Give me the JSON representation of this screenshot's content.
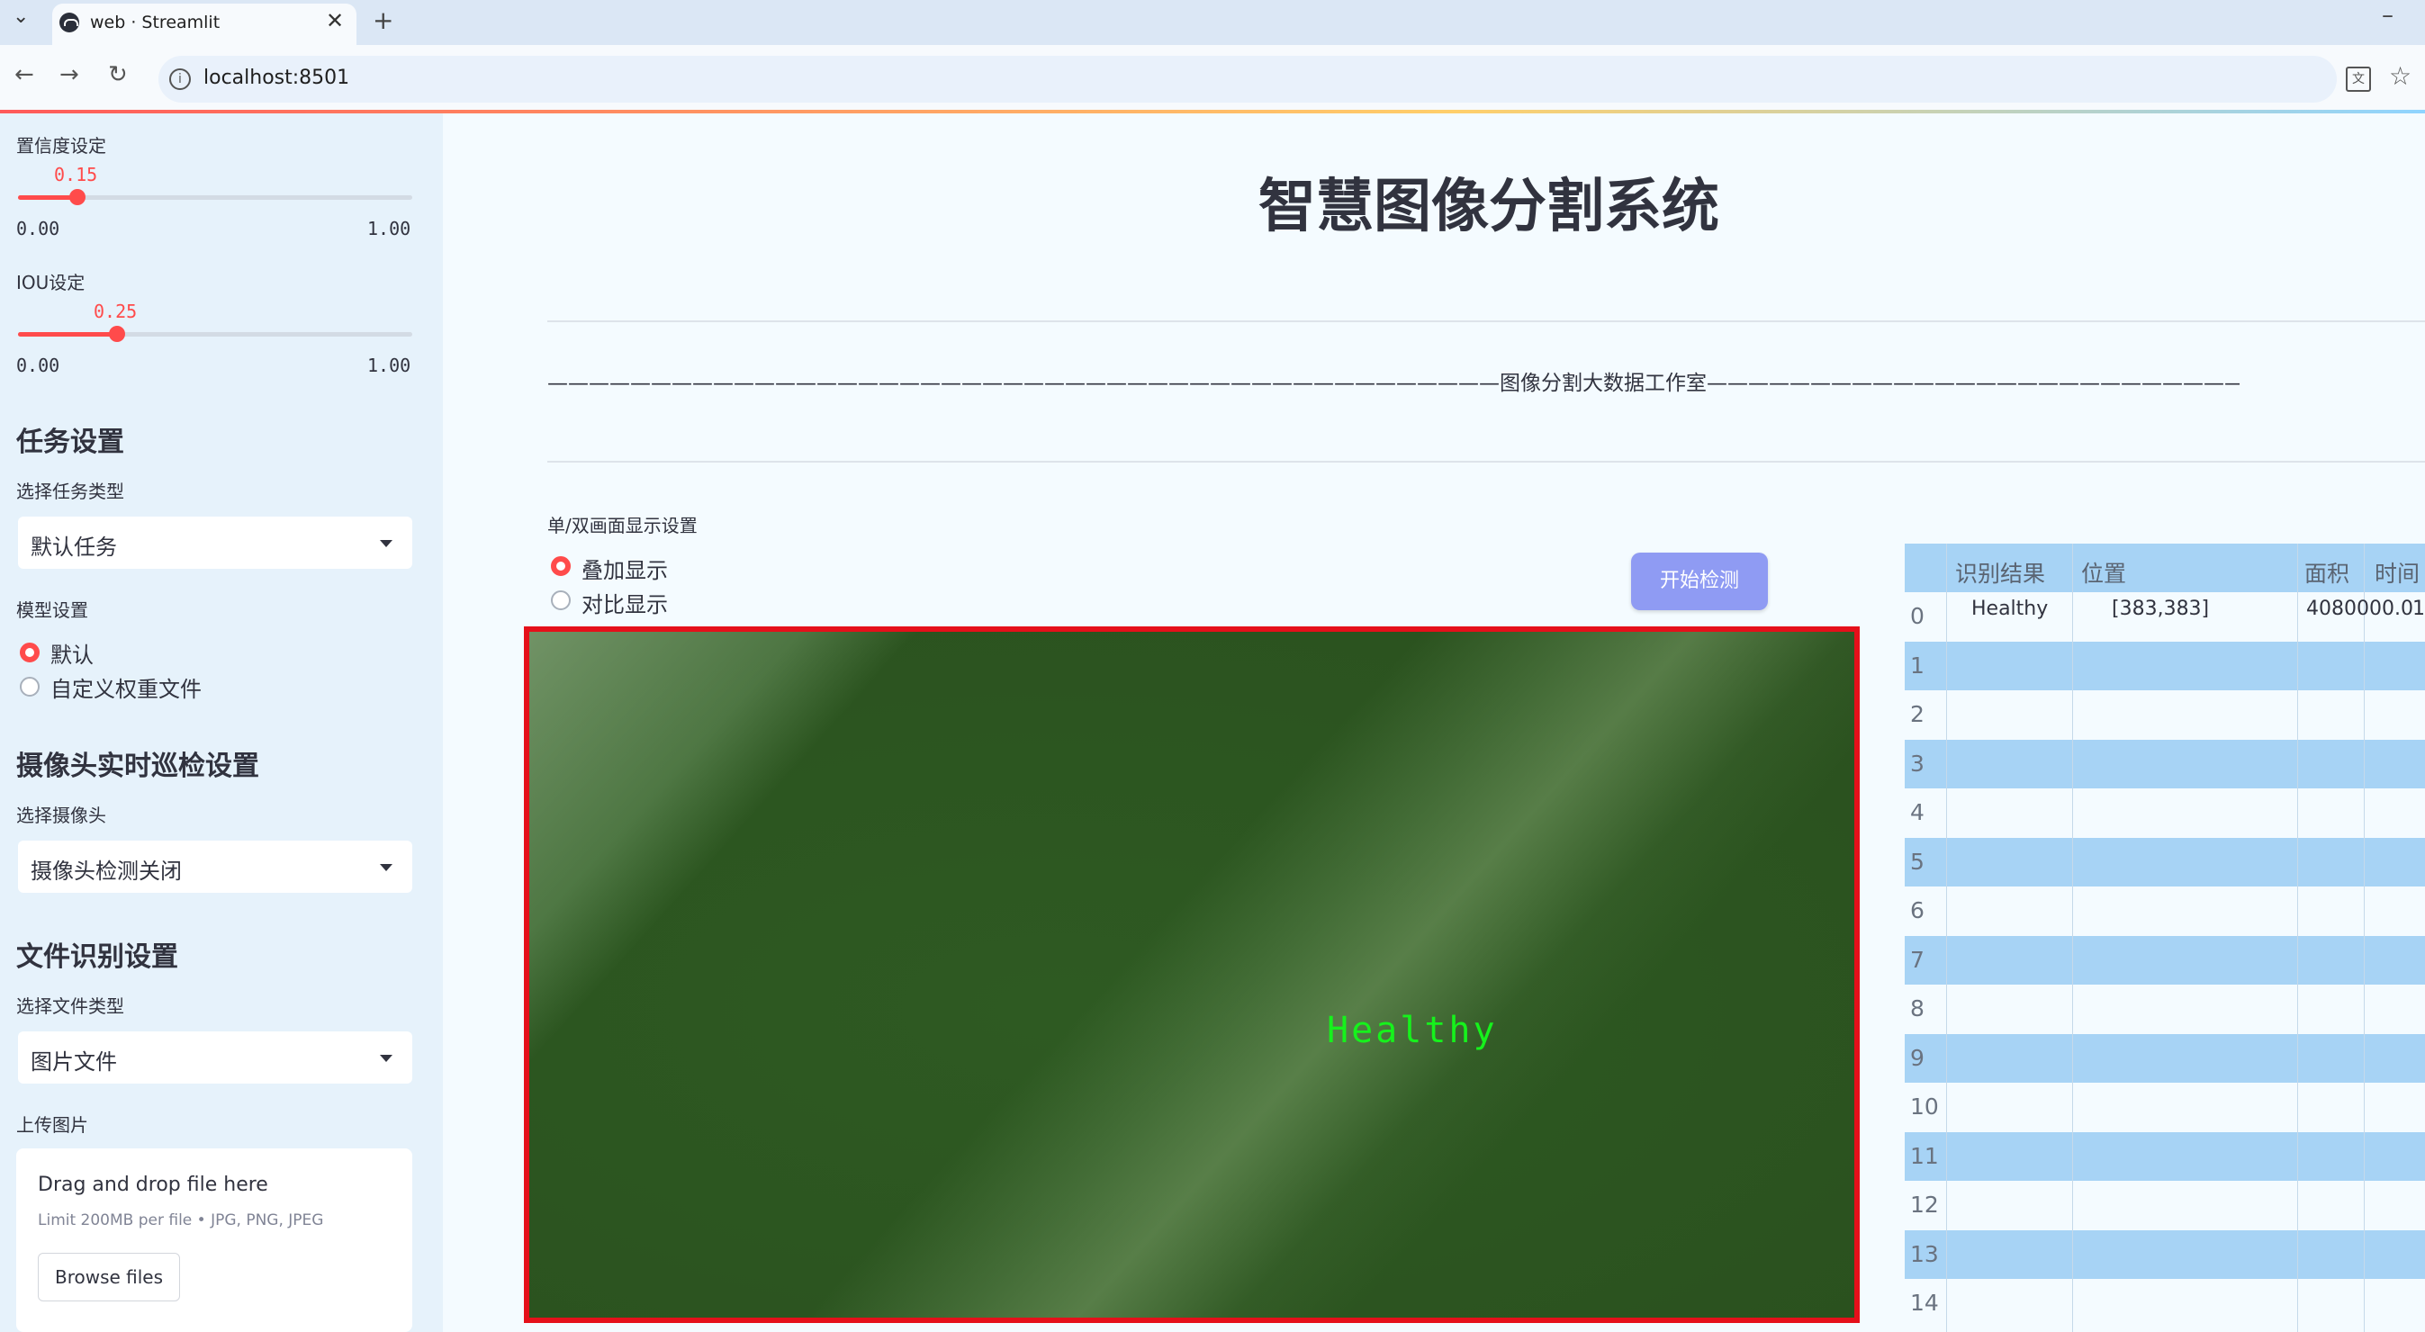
{
  "browser": {
    "tab_title": "web · Streamlit",
    "url": "localhost:8501"
  },
  "sidebar": {
    "confidence": {
      "label": "置信度设定",
      "value": "0.15",
      "fraction": 0.15,
      "min": "0.00",
      "max": "1.00"
    },
    "iou": {
      "label": "IOU设定",
      "value": "0.25",
      "fraction": 0.25,
      "min": "0.00",
      "max": "1.00"
    },
    "task_header": "任务设置",
    "task_type_label": "选择任务类型",
    "task_type_value": "默认任务",
    "model_label": "模型设置",
    "model_options": [
      "默认",
      "自定义权重文件"
    ],
    "model_selected": "默认",
    "camera_header": "摄像头实时巡检设置",
    "camera_label": "选择摄像头",
    "camera_value": "摄像头检测关闭",
    "file_header": "文件识别设置",
    "file_type_label": "选择文件类型",
    "file_type_value": "图片文件",
    "upload_label": "上传图片",
    "upload_main": "Drag and drop file here",
    "upload_sub": "Limit 200MB per file • JPG, PNG, JPEG",
    "browse_label": "Browse files"
  },
  "main": {
    "title": "智慧图像分割系统",
    "subtitle": "——————————————————————————————————————————————图像分割大数据工作室——————————————————————————————————————————————",
    "display_label": "单/双画面显示设置",
    "display_options": [
      "叠加显示",
      "对比显示"
    ],
    "display_selected": "叠加显示",
    "start_button": "开始检测",
    "overlay_text": "Healthy"
  },
  "table": {
    "columns": [
      "识别结果",
      "位置",
      "面积",
      "时间"
    ],
    "rows": [
      {
        "index": "0",
        "result": "Healthy",
        "position": "[383,383]",
        "area": "4080000.0",
        "time": "1"
      }
    ],
    "row_indices": [
      "0",
      "1",
      "2",
      "3",
      "4",
      "5",
      "6",
      "7",
      "8",
      "9",
      "10",
      "11",
      "12",
      "13",
      "14"
    ]
  },
  "colors": {
    "accent": "#ff4b4b",
    "button": "#8f9bf3",
    "frame": "#e5101a",
    "label_green": "#16f21c",
    "table_stripe": "#a7d3f5"
  }
}
